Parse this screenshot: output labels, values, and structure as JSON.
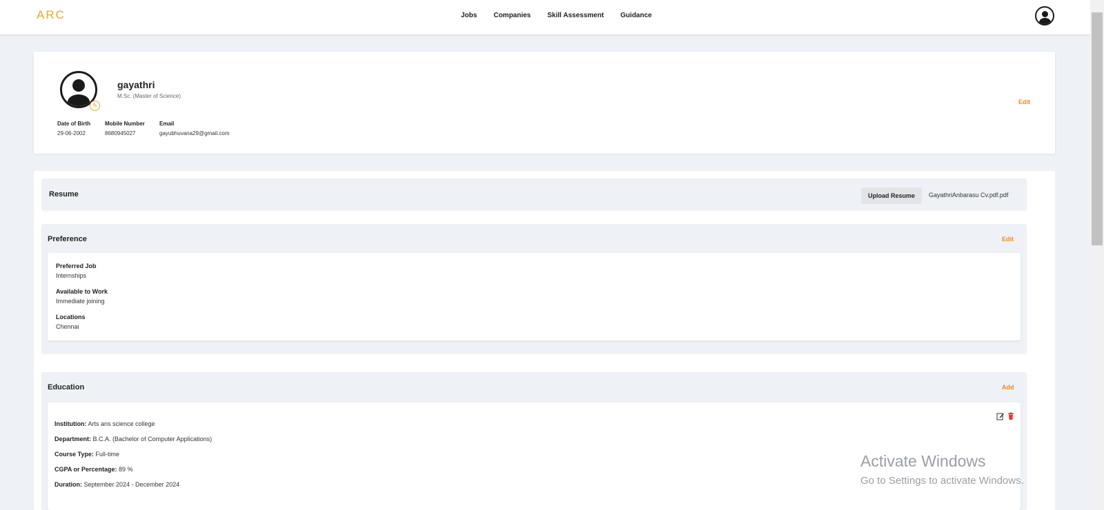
{
  "header": {
    "logo": "ARC",
    "nav": [
      "Jobs",
      "Companies",
      "Skill Assessment",
      "Guidance"
    ],
    "profile_icon": "user-circle-icon"
  },
  "profile": {
    "name": "gayathri",
    "degree": "M.Sc. (Master of Science)",
    "edit_label": "Edit",
    "dob_label": "Date of Birth",
    "dob": "29-06-2002",
    "mobile_label": "Mobile Number",
    "mobile": "8680945027",
    "email_label": "Email",
    "email": "gayubhuvana29@gmail.com"
  },
  "resume": {
    "title": "Resume",
    "upload_label": "Upload Resume",
    "file_name": "GayathriAnbarasu Cv.pdf.pdf"
  },
  "preference": {
    "title": "Preference",
    "edit_label": "Edit",
    "preferred_job_label": "Preferred Job",
    "preferred_job": "Internships",
    "available_label": "Available to Work",
    "available": "Immediate joining",
    "locations_label": "Locations",
    "locations": "Chennai"
  },
  "education": {
    "title": "Education",
    "add_label": "Add",
    "institution_label": "Institution:",
    "institution": "Arts ans science college",
    "department_label": "Department:",
    "department": "B.C.A. (Bachelor of Computer Applications)",
    "course_type_label": "Course Type:",
    "course_type": "Full-time",
    "cgpa_label": "CGPA or Percentage:",
    "cgpa": "89 %",
    "duration_label": "Duration:",
    "duration": "September 2024 - December 2024"
  },
  "watermark": {
    "title": "Activate Windows",
    "subtitle": "Go to Settings to activate Windows."
  },
  "colors": {
    "accent": "#f08a24",
    "logo": "#e0ad2a",
    "delete": "#e03a3a"
  }
}
